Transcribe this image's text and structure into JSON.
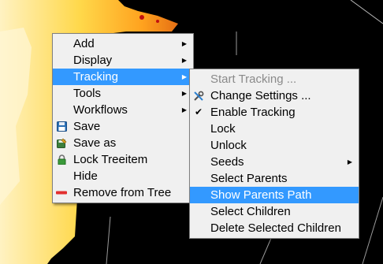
{
  "background": {
    "description_colors": [
      "#fff1b8",
      "#ffd84a",
      "#ff9a1c",
      "#e2701a",
      "#000000"
    ]
  },
  "context_menu": {
    "items": [
      {
        "label": "Add",
        "submenu": true,
        "icon": null
      },
      {
        "label": "Display",
        "submenu": true,
        "icon": null
      },
      {
        "label": "Tracking",
        "submenu": true,
        "icon": null,
        "selected": true
      },
      {
        "label": "Tools",
        "submenu": true,
        "icon": null
      },
      {
        "label": "Workflows",
        "submenu": true,
        "icon": null
      },
      {
        "label": "Save",
        "submenu": false,
        "icon": "floppy-disk-icon"
      },
      {
        "label": "Save as",
        "submenu": false,
        "icon": "save-as-icon"
      },
      {
        "label": "Lock Treeitem",
        "submenu": false,
        "icon": "lock-icon"
      },
      {
        "label": "Hide",
        "submenu": false,
        "icon": null
      },
      {
        "label": "Remove from Tree",
        "submenu": false,
        "icon": "remove-icon"
      }
    ]
  },
  "tracking_submenu": {
    "items": [
      {
        "label": "Start Tracking ...",
        "disabled": true
      },
      {
        "label": "Change Settings ...",
        "icon": "tools-icon"
      },
      {
        "label": "Enable Tracking",
        "checked": true
      },
      {
        "label": "Lock"
      },
      {
        "label": "Unlock"
      },
      {
        "label": "Seeds",
        "submenu": true
      },
      {
        "label": "Select Parents"
      },
      {
        "label": "Show Parents Path",
        "selected": true
      },
      {
        "label": "Select Children"
      },
      {
        "label": "Delete Selected Children"
      }
    ]
  },
  "colors": {
    "highlight": "#3399ff",
    "menu_bg": "#f0f0f0",
    "disabled_text": "#8a8a8a"
  }
}
